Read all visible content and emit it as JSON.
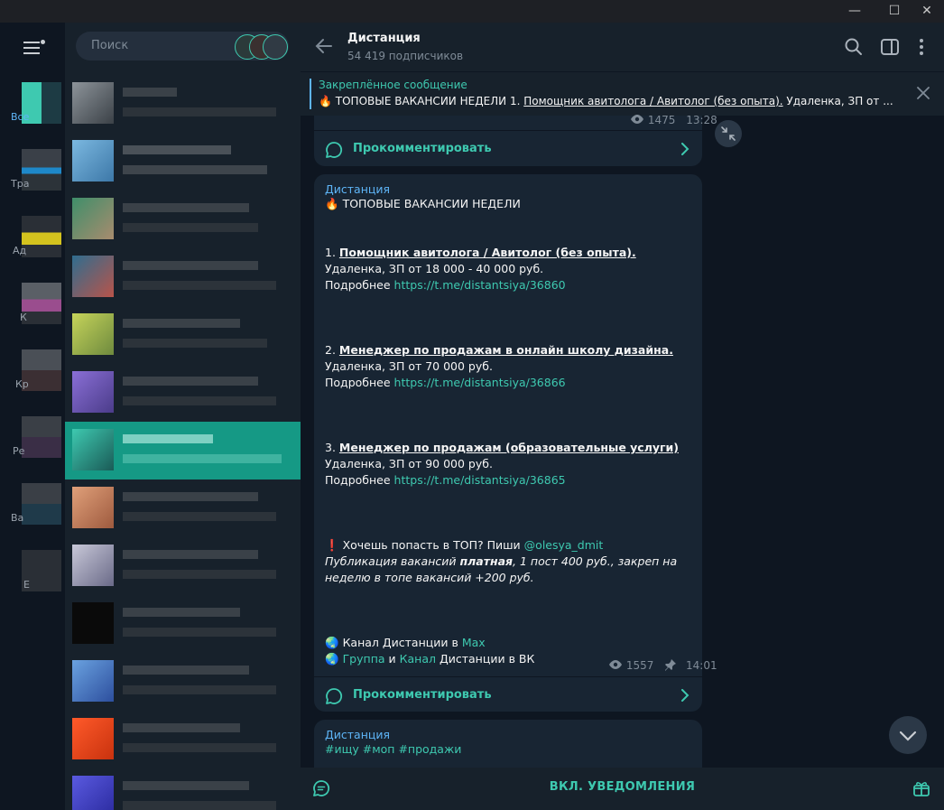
{
  "window": {
    "minimize_glyph": "—",
    "maximize_glyph": "☐",
    "close_glyph": "✕"
  },
  "search": {
    "placeholder": "Поиск"
  },
  "folders": [
    {
      "label": "Все"
    },
    {
      "label": "Тра"
    },
    {
      "label": "Ад"
    },
    {
      "label": "К"
    },
    {
      "label": "Кр"
    },
    {
      "label": "Ре"
    },
    {
      "label": "Ва"
    },
    {
      "label": "Е"
    }
  ],
  "chat_header": {
    "title": "Дистанция",
    "subtitle": "54 419 подписчиков"
  },
  "pinned": {
    "title": "Закреплённое сообщение",
    "emoji": "🔥",
    "text_prefix": "ТОПОВЫЕ ВАКАНСИИ НЕДЕЛИ   1. ",
    "text_link": "Помощник авитолога / Авитолог (без опыта).",
    "text_suffix": " Удаленка, ЗП от ..."
  },
  "messages": [
    {
      "views": "1475",
      "time": "13:28",
      "comment_label": "Прокомментировать"
    },
    {
      "sender": "Дистанция",
      "headline_emoji": "🔥",
      "headline": "ТОПОВЫЕ ВАКАНСИИ НЕДЕЛИ",
      "vacancies": [
        {
          "num": "1.",
          "title": "Помощник авитолога / Авитолог (без опыта).",
          "salary": "Удаленка, ЗП от 18 000 - 40 000 руб.",
          "more_label": "Подробнее",
          "link": "https://t.me/distantsiya/36860"
        },
        {
          "num": "2.",
          "title": "Менеджер по продажам в онлайн школу дизайна.",
          "salary": "Удаленка, ЗП от 70 000 руб.",
          "more_label": "Подробнее",
          "link": "https://t.me/distantsiya/36866"
        },
        {
          "num": "3.",
          "title": "Менеджер по продажам (образовательные услуги)",
          "salary": "Удаленка, ЗП от 90 000 руб.",
          "more_label": "Подробнее",
          "link": "https://t.me/distantsiya/36865"
        }
      ],
      "cta_emoji": "❗",
      "cta_text": "Хочешь попасть в ТОП? Пиши",
      "cta_handle": "@olesya_dmit",
      "note_1": "Публикация вакансий",
      "note_bold": "платная",
      "note_2": ", 1 пост 400 руб., закреп на неделю в топе вакансий +200 руб.",
      "footer_emoji": "🌏",
      "footer_line1_text": "Канал Дистанции в",
      "footer_line1_link": "Max",
      "footer_line2_link1": "Группа",
      "footer_line2_and": "и",
      "footer_line2_link2": "Канал",
      "footer_line2_text": "Дистанции в ВК",
      "views": "1557",
      "time": "14:01",
      "comment_label": "Прокомментировать"
    },
    {
      "sender": "Дистанция",
      "tags": "#ищу #моп #продажи"
    }
  ],
  "bottom": {
    "notif_label": "ВКЛ. УВЕДОМЛЕНИЯ"
  },
  "colors": {
    "accent": "#3ec9b0",
    "link_blue": "#5eb5f7",
    "bubble": "#182533",
    "chat_bg": "#0e1621",
    "panel": "#17212b",
    "selected_row": "#159985"
  }
}
